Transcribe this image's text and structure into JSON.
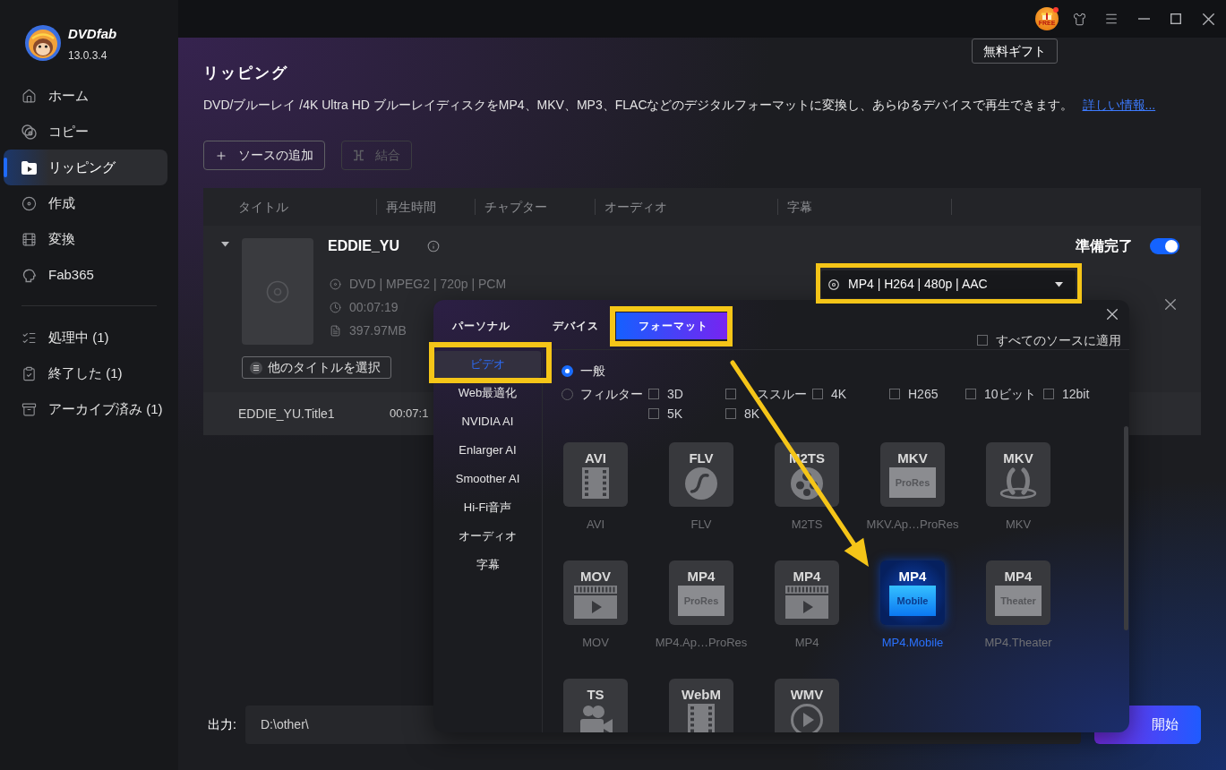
{
  "app": {
    "name": "DVDfab",
    "version": "13.0.3.4"
  },
  "sidebar": {
    "items": [
      {
        "label": "ホーム",
        "selected": false
      },
      {
        "label": "コピー",
        "selected": false
      },
      {
        "label": "リッピング",
        "selected": true
      },
      {
        "label": "作成",
        "selected": false
      },
      {
        "label": "変換",
        "selected": false
      },
      {
        "label": "Fab365",
        "selected": false
      }
    ],
    "queue": [
      {
        "label": "処理中 (1)",
        "selected": false
      },
      {
        "label": "終了した (1)",
        "selected": false
      },
      {
        "label": "アーカイブ済み (1)",
        "selected": false
      }
    ]
  },
  "title_bar": {
    "gift_label": "FREE",
    "notification": true,
    "tooltip": "無料ギフト"
  },
  "page": {
    "title": "リッピング",
    "description": "DVD/ブルーレイ /4K Ultra HD ブルーレイディスクをMP4、MKV、MP3、FLACなどのデジタルフォーマットに変換し、あらゆるデバイスで再生できます。",
    "link": "詳しい情報..."
  },
  "toolbar": [
    {
      "label": "ソースの追加",
      "disabled": false
    },
    {
      "label": "結合",
      "disabled": true
    }
  ],
  "table": {
    "columns": [
      "タイトル",
      "再生時間",
      "チャプター",
      "オーディオ",
      "字幕"
    ]
  },
  "source": {
    "expanded": true,
    "title": "EDDIE_YU",
    "details": [
      "DVD | MPEG2 | 720p | PCM",
      "00:07:19",
      "397.97MB"
    ],
    "select_button": "他のタイトルを選択",
    "ready": {
      "label": "準備完了",
      "on": true
    },
    "profile": "MP4 | H264 | 480p | AAC",
    "titles": [
      {
        "name": "EDDIE_YU.Title1",
        "duration": "00:07:1"
      }
    ]
  },
  "format_popup": {
    "tabs": [
      {
        "label": "パーソナル",
        "selected": false
      },
      {
        "label": "デバイス",
        "selected": false
      },
      {
        "label": "フォーマット",
        "selected": true
      }
    ],
    "apply_all": {
      "label": "すべてのソースに適用",
      "checked": false
    },
    "categories": [
      {
        "label": "ビデオ",
        "selected": true
      },
      {
        "label": "Web最適化",
        "selected": false
      },
      {
        "label": "NVIDIA AI",
        "selected": false
      },
      {
        "label": "Enlarger AI",
        "selected": false
      },
      {
        "label": "Smoother AI",
        "selected": false
      },
      {
        "label": "Hi-Fi音声",
        "selected": false
      },
      {
        "label": "オーディオ",
        "selected": false
      },
      {
        "label": "字幕",
        "selected": false
      }
    ],
    "modes": [
      {
        "label": "一般",
        "selected": true
      },
      {
        "label": "フィルター",
        "selected": false,
        "filter_rows": [
          [
            {
              "label": "3D",
              "checked": false
            },
            {
              "label": "ススルー",
              "checked": false
            },
            {
              "label": "4K",
              "checked": false
            },
            {
              "label": "H265",
              "checked": false
            },
            {
              "label": "10ビット",
              "checked": false
            },
            {
              "label": "12bit",
              "checked": false
            }
          ],
          [
            {
              "label": "5K",
              "checked": false
            },
            {
              "label": "8K",
              "checked": false
            }
          ]
        ]
      }
    ],
    "formats": [
      {
        "badge": "AVI",
        "kind": "film",
        "label": "AVI",
        "selected": false
      },
      {
        "badge": "FLV",
        "kind": "flash",
        "label": "FLV",
        "selected": false
      },
      {
        "badge": "M2TS",
        "kind": "reel",
        "label": "M2TS",
        "selected": false
      },
      {
        "badge": "MKV",
        "kind": "plate",
        "plate": "ProRes",
        "label": "MKV.Ap…ProRes",
        "selected": false
      },
      {
        "badge": "MKV",
        "kind": "figure",
        "label": "MKV",
        "selected": false
      },
      {
        "badge": "MOV",
        "kind": "clip",
        "label": "MOV",
        "selected": false
      },
      {
        "badge": "MP4",
        "kind": "plate",
        "plate": "ProRes",
        "label": "MP4.Ap…ProRes",
        "selected": false
      },
      {
        "badge": "MP4",
        "kind": "clip",
        "label": "MP4",
        "selected": false
      },
      {
        "badge": "MP4",
        "kind": "plate",
        "plate": "Mobile",
        "label": "MP4.Mobile",
        "selected": true
      },
      {
        "badge": "MP4",
        "kind": "plate",
        "plate": "Theater",
        "label": "MP4.Theater",
        "selected": false
      },
      {
        "badge": "TS",
        "kind": "camera",
        "selected": false
      },
      {
        "badge": "WebM",
        "kind": "film",
        "selected": false
      },
      {
        "badge": "WMV",
        "kind": "play",
        "selected": false
      }
    ]
  },
  "output": {
    "label": "出力:",
    "path": "D:\\other\\"
  },
  "start_button": "開始"
}
